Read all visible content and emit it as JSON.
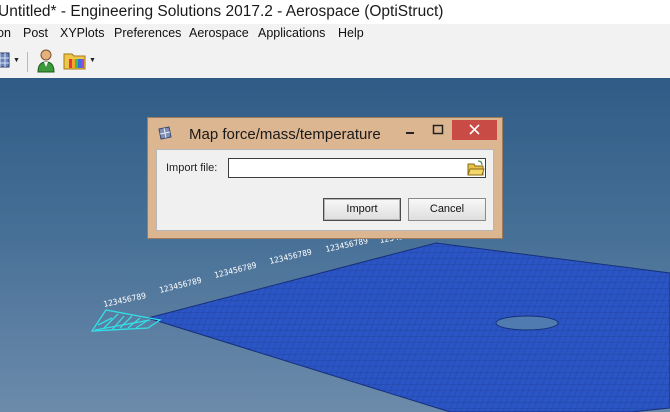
{
  "window": {
    "title": "Untitled* - Engineering Solutions 2017.2 - Aerospace (OptiStruct)"
  },
  "menu": {
    "items": [
      {
        "label": "on"
      },
      {
        "label": "Post"
      },
      {
        "label": "XYPlots"
      },
      {
        "label": "Preferences"
      },
      {
        "label": "Aerospace"
      },
      {
        "label": "Applications"
      },
      {
        "label": "Help"
      }
    ]
  },
  "toolbar": {
    "icons": [
      "grid-icon",
      "user-icon",
      "folder-palette-icon"
    ]
  },
  "dialog": {
    "title": "Map force/mass/temperature",
    "import_label": "Import file:",
    "import_value": "",
    "import_button": "Import",
    "cancel_button": "Cancel",
    "title_icon": "mesh-icon",
    "browse_icon": "open-folder-icon"
  },
  "viewport": {
    "background_top": "#2f5c86",
    "background_bottom": "#6c8bab",
    "plate_color": "#2b55c4",
    "load_color": "#33e0e8",
    "load_labels": "123456789"
  }
}
